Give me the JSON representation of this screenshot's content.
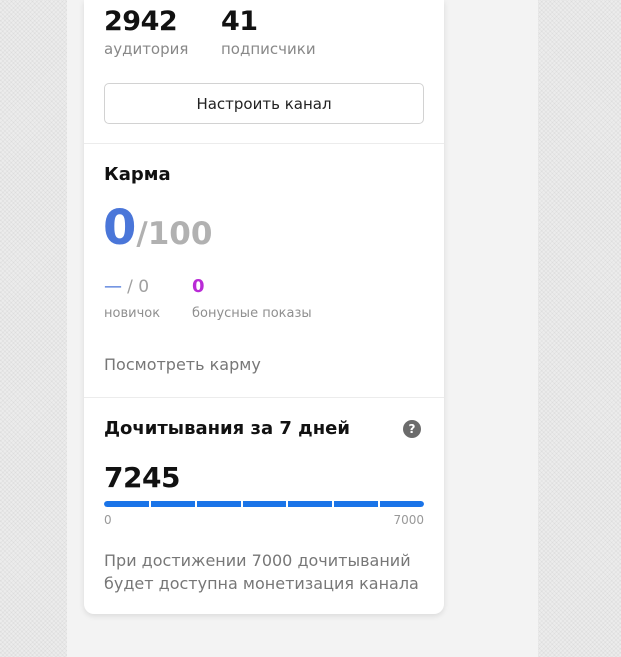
{
  "stats": {
    "audience": {
      "value": "2942",
      "label": "аудитория"
    },
    "subscribers": {
      "value": "41",
      "label": "подписчики"
    },
    "configure_button": "Настроить канал"
  },
  "karma": {
    "title": "Карма",
    "value": "0",
    "max": "/100",
    "novice": {
      "dash": "—",
      "suffix": "/ 0",
      "label": "новичок"
    },
    "bonus": {
      "value": "0",
      "label": "бонусные показы"
    },
    "link": "Посмотреть карму"
  },
  "reads": {
    "title": "Дочитывания за 7 дней",
    "help_icon": "question-icon",
    "help_glyph": "?",
    "value": "7245",
    "progress_fraction": 1.0,
    "scale_min": "0",
    "scale_max": "7000",
    "info": "При достижении 7000 дочитываний будет доступна монетизация канала"
  },
  "colors": {
    "karma_accent": "#4a76d9",
    "bonus_accent": "#b92bd6",
    "progress": "#1a74e8"
  }
}
